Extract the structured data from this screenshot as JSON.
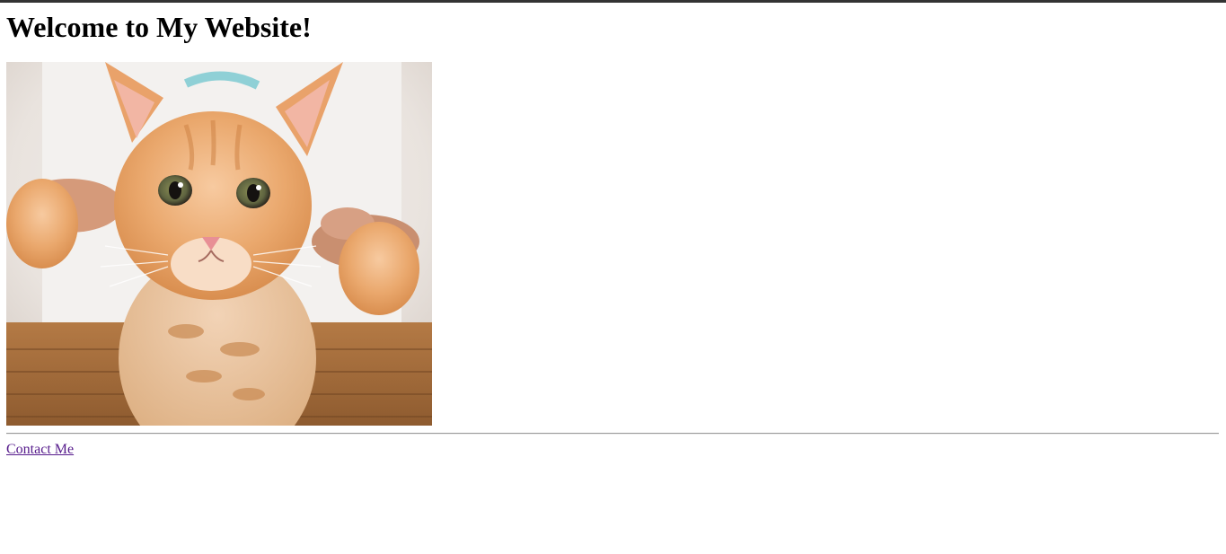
{
  "page": {
    "title": "Welcome to My Website!"
  },
  "hero_image": {
    "subject": "orange-tabby-kitten-photo"
  },
  "footer": {
    "contact_label": "Contact Me"
  },
  "colors": {
    "link_visited": "#551a8b",
    "top_bar": "#333333",
    "rule": "#9a9a9a"
  }
}
